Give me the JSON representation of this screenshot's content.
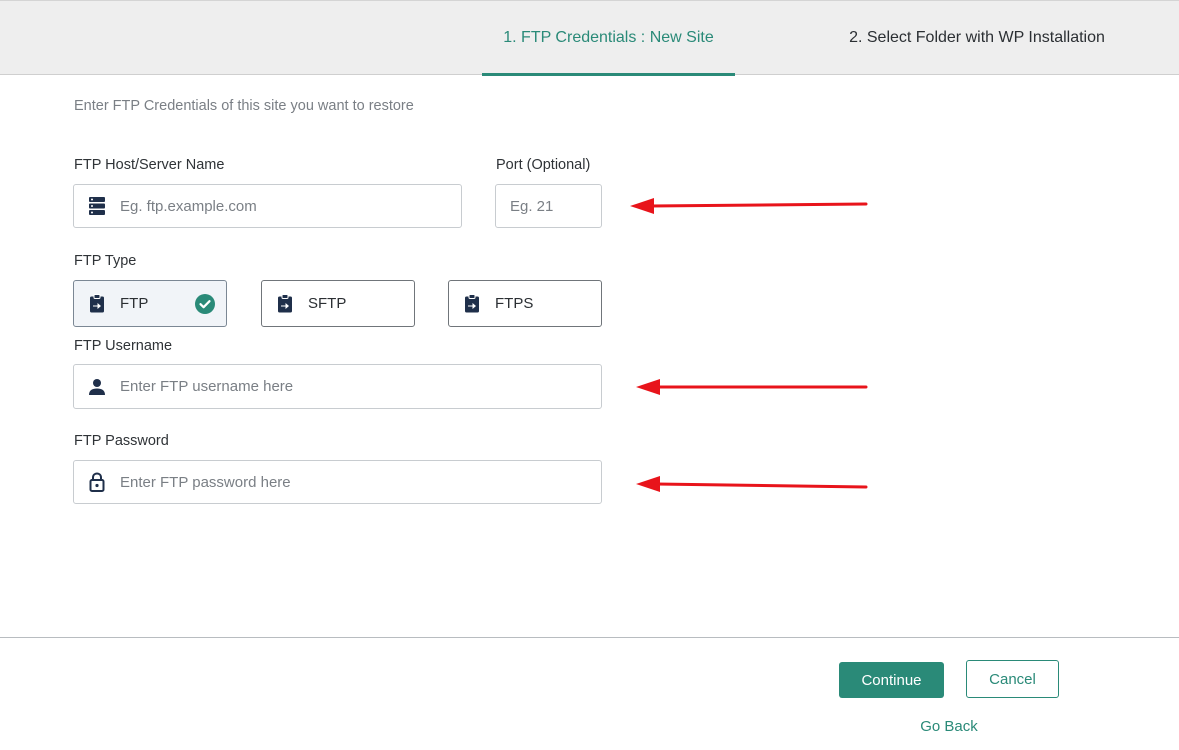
{
  "tabs": [
    {
      "label": "1. FTP Credentials : New Site",
      "active": true
    },
    {
      "label": "2. Select Folder with WP Installation",
      "active": false
    }
  ],
  "intro": "Enter FTP Credentials of this site you want to restore",
  "host": {
    "label": "FTP Host/Server Name",
    "placeholder": "Eg. ftp.example.com",
    "value": "",
    "icon": "server-icon"
  },
  "port": {
    "label": "Port (Optional)",
    "placeholder": "Eg. 21",
    "value": ""
  },
  "ftp_type": {
    "label": "FTP Type",
    "options": [
      {
        "label": "FTP",
        "selected": true,
        "icon": "clipboard-arrow-icon"
      },
      {
        "label": "SFTP",
        "selected": false,
        "icon": "clipboard-arrow-icon"
      },
      {
        "label": "FTPS",
        "selected": false,
        "icon": "clipboard-arrow-icon"
      }
    ]
  },
  "username": {
    "label": "FTP Username",
    "placeholder": "Enter FTP username here",
    "value": "",
    "icon": "user-icon"
  },
  "password": {
    "label": "FTP Password",
    "placeholder": "Enter FTP password here",
    "value": "",
    "icon": "lock-icon"
  },
  "actions": {
    "continue_label": "Continue",
    "cancel_label": "Cancel",
    "go_back_label": "Go Back"
  },
  "colors": {
    "accent": "#2a8a78",
    "annotation_arrow": "#e8141b",
    "icon_dark": "#1f2f4a"
  }
}
